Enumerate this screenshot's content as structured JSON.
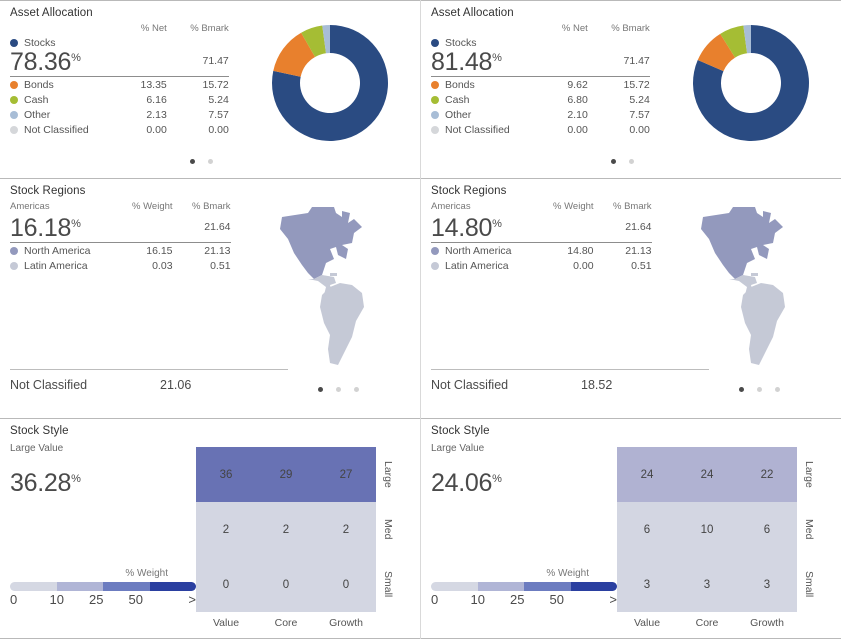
{
  "colors": {
    "stocks": "#2a4b82",
    "bonds": "#e8802d",
    "cash": "#a5bd34",
    "other": "#a8bdd6",
    "not_classified": "#d5d7da",
    "north_america": "#9399bd",
    "latin_america": "#c5c9d6",
    "grad_1": "#d5d8e3",
    "grad_2": "#b0b5d6",
    "grad_3": "#6c7cc0",
    "grad_4": "#2a3fa0",
    "box_large_left": "#6872b4",
    "box_large_right": "#b0b2d2",
    "box_light": "#d3d6e2"
  },
  "panels": {
    "asset_allocation_title": "Asset Allocation",
    "stock_regions_title": "Stock Regions",
    "stock_style_title": "Stock Style"
  },
  "left": {
    "allocation": {
      "col_net": "% Net",
      "col_bmark": "% Bmark",
      "hero_name": "Stocks",
      "hero_value": "78.36",
      "hero_pct": "%",
      "hero_bmark": "71.47",
      "rows": [
        {
          "label": "Bonds",
          "net": "13.35",
          "bmark": "15.72",
          "color_key": "bonds"
        },
        {
          "label": "Cash",
          "net": "6.16",
          "bmark": "5.24",
          "color_key": "cash"
        },
        {
          "label": "Other",
          "net": "2.13",
          "bmark": "7.57",
          "color_key": "other"
        },
        {
          "label": "Not Classified",
          "net": "0.00",
          "bmark": "0.00",
          "color_key": "not_classified"
        }
      ],
      "donut": [
        {
          "name": "Stocks",
          "value": 78.36,
          "color": "#2a4b82"
        },
        {
          "name": "Bonds",
          "value": 13.35,
          "color": "#e8802d"
        },
        {
          "name": "Cash",
          "value": 6.16,
          "color": "#a5bd34"
        },
        {
          "name": "Other",
          "value": 2.13,
          "color": "#a8bdd6"
        }
      ],
      "dots": {
        "count": 2,
        "active": 0
      }
    },
    "regions": {
      "col_weight": "% Weight",
      "col_bmark": "% Bmark",
      "hero_name": "Americas",
      "hero_value": "16.18",
      "hero_pct": "%",
      "hero_bmark": "21.64",
      "rows": [
        {
          "label": "North America",
          "weight": "16.15",
          "bmark": "21.13",
          "color_key": "north_america"
        },
        {
          "label": "Latin America",
          "weight": "0.03",
          "bmark": "0.51",
          "color_key": "latin_america"
        }
      ],
      "not_classified_label": "Not Classified",
      "not_classified_value": "21.06",
      "dots": {
        "count": 3,
        "active": 0
      }
    },
    "style": {
      "category": "Large Value",
      "hero_value": "36.28",
      "hero_pct": "%",
      "legend_title": "% Weight",
      "legend_ticks": [
        "0",
        "10",
        "25",
        "50",
        ">"
      ],
      "row_labels": [
        "Large",
        "Med",
        "Small"
      ],
      "col_labels": [
        "Value",
        "Core",
        "Growth"
      ],
      "cells": [
        [
          "36",
          "29",
          "27"
        ],
        [
          "2",
          "2",
          "2"
        ],
        [
          "0",
          "0",
          "0"
        ]
      ],
      "highlight_row": 0
    }
  },
  "right": {
    "allocation": {
      "col_net": "% Net",
      "col_bmark": "% Bmark",
      "hero_name": "Stocks",
      "hero_value": "81.48",
      "hero_pct": "%",
      "hero_bmark": "71.47",
      "rows": [
        {
          "label": "Bonds",
          "net": "9.62",
          "bmark": "15.72",
          "color_key": "bonds"
        },
        {
          "label": "Cash",
          "net": "6.80",
          "bmark": "5.24",
          "color_key": "cash"
        },
        {
          "label": "Other",
          "net": "2.10",
          "bmark": "7.57",
          "color_key": "other"
        },
        {
          "label": "Not Classified",
          "net": "0.00",
          "bmark": "0.00",
          "color_key": "not_classified"
        }
      ],
      "donut": [
        {
          "name": "Stocks",
          "value": 81.48,
          "color": "#2a4b82"
        },
        {
          "name": "Bonds",
          "value": 9.62,
          "color": "#e8802d"
        },
        {
          "name": "Cash",
          "value": 6.8,
          "color": "#a5bd34"
        },
        {
          "name": "Other",
          "value": 2.1,
          "color": "#a8bdd6"
        }
      ],
      "dots": {
        "count": 2,
        "active": 0
      }
    },
    "regions": {
      "col_weight": "% Weight",
      "col_bmark": "% Bmark",
      "hero_name": "Americas",
      "hero_value": "14.80",
      "hero_pct": "%",
      "hero_bmark": "21.64",
      "rows": [
        {
          "label": "North America",
          "weight": "14.80",
          "bmark": "21.13",
          "color_key": "north_america"
        },
        {
          "label": "Latin America",
          "weight": "0.00",
          "bmark": "0.51",
          "color_key": "latin_america"
        }
      ],
      "not_classified_label": "Not Classified",
      "not_classified_value": "18.52",
      "dots": {
        "count": 3,
        "active": 0
      }
    },
    "style": {
      "category": "Large Value",
      "hero_value": "24.06",
      "hero_pct": "%",
      "legend_title": "% Weight",
      "legend_ticks": [
        "0",
        "10",
        "25",
        "50",
        ">"
      ],
      "row_labels": [
        "Large",
        "Med",
        "Small"
      ],
      "col_labels": [
        "Value",
        "Core",
        "Growth"
      ],
      "cells": [
        [
          "24",
          "24",
          "22"
        ],
        [
          "6",
          "10",
          "6"
        ],
        [
          "3",
          "3",
          "3"
        ]
      ],
      "highlight_row": 0
    }
  }
}
